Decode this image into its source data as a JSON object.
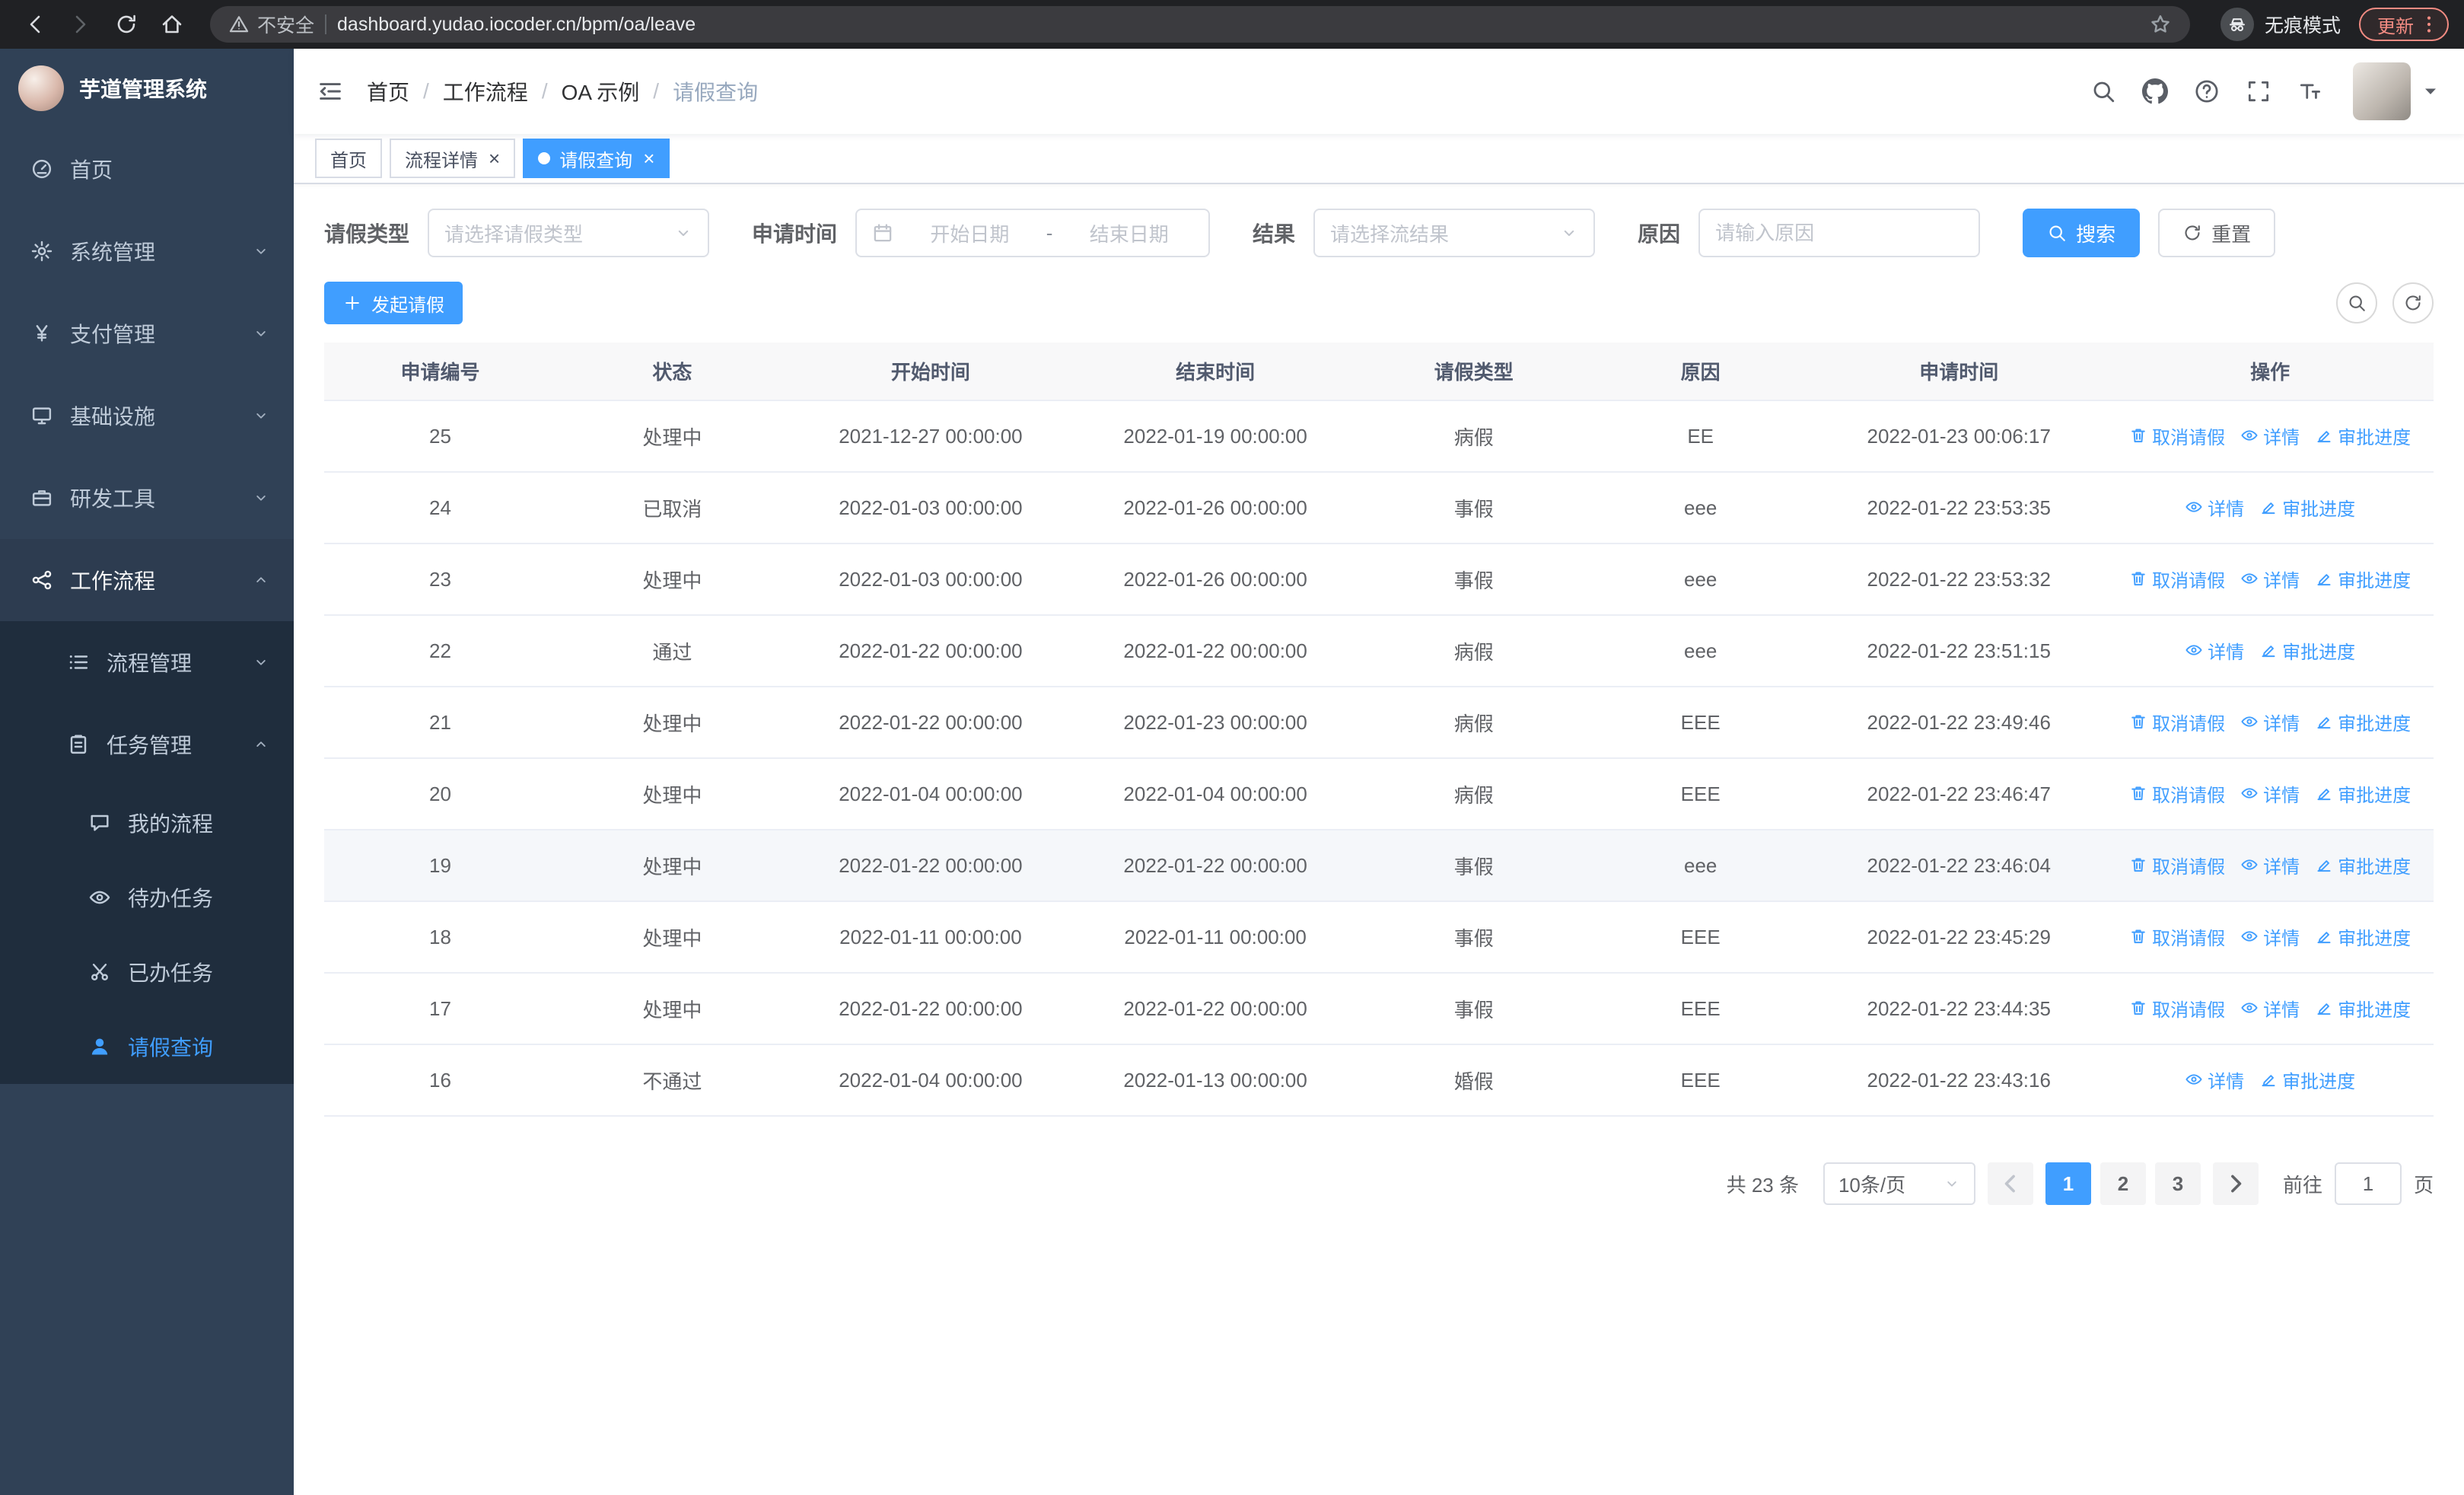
{
  "browser": {
    "security_label": "不安全",
    "url": "dashboard.yudao.iocoder.cn/bpm/oa/leave",
    "incognito_label": "无痕模式",
    "update_label": "更新"
  },
  "sidebar": {
    "title": "芋道管理系统",
    "items": [
      {
        "label": "首页",
        "icon": "dashboard-icon",
        "group": false,
        "expanded": false
      },
      {
        "label": "系统管理",
        "icon": "gear-icon",
        "group": true,
        "expanded": false
      },
      {
        "label": "支付管理",
        "icon": "yen-icon",
        "group": true,
        "expanded": false
      },
      {
        "label": "基础设施",
        "icon": "monitor-icon",
        "group": true,
        "expanded": false
      },
      {
        "label": "研发工具",
        "icon": "briefcase-icon",
        "group": true,
        "expanded": false
      },
      {
        "label": "工作流程",
        "icon": "workflow-icon",
        "group": true,
        "expanded": true
      }
    ],
    "submenu": [
      {
        "label": "流程管理",
        "icon": "list-icon",
        "level": 1,
        "group": true,
        "expanded": false,
        "active": false
      },
      {
        "label": "任务管理",
        "icon": "clipboard-icon",
        "level": 1,
        "group": true,
        "expanded": true,
        "active": false
      },
      {
        "label": "我的流程",
        "icon": "chat-icon",
        "level": 2,
        "group": false,
        "active": false
      },
      {
        "label": "待办任务",
        "icon": "eye-icon",
        "level": 2,
        "group": false,
        "active": false
      },
      {
        "label": "已办任务",
        "icon": "scissors-icon",
        "level": 2,
        "group": false,
        "active": false
      },
      {
        "label": "请假查询",
        "icon": "user-icon",
        "level": 2,
        "group": false,
        "active": true
      }
    ]
  },
  "header": {
    "breadcrumb": [
      "首页",
      "工作流程",
      "OA 示例",
      "请假查询"
    ]
  },
  "tabs": [
    {
      "label": "首页",
      "closable": false,
      "active": false
    },
    {
      "label": "流程详情",
      "closable": true,
      "active": false
    },
    {
      "label": "请假查询",
      "closable": true,
      "active": true
    }
  ],
  "filters": {
    "leave_type_label": "请假类型",
    "leave_type_placeholder": "请选择请假类型",
    "apply_time_label": "申请时间",
    "start_date_placeholder": "开始日期",
    "range_separator": "-",
    "end_date_placeholder": "结束日期",
    "result_label": "结果",
    "result_placeholder": "请选择流结果",
    "reason_label": "原因",
    "reason_placeholder": "请输入原因",
    "search_button": "搜索",
    "reset_button": "重置"
  },
  "toolbar": {
    "create_button": "发起请假"
  },
  "table": {
    "columns": [
      "申请编号",
      "状态",
      "开始时间",
      "结束时间",
      "请假类型",
      "原因",
      "申请时间",
      "操作"
    ],
    "action_labels": {
      "cancel": "取消请假",
      "detail": "详情",
      "progress": "审批进度"
    },
    "rows": [
      {
        "id": "25",
        "status": "处理中",
        "start": "2021-12-27 00:00:00",
        "end": "2022-01-19 00:00:00",
        "type": "病假",
        "reason": "EE",
        "apply_time": "2022-01-23 00:06:17",
        "actions": [
          "cancel",
          "detail",
          "progress"
        ],
        "highlighted": false
      },
      {
        "id": "24",
        "status": "已取消",
        "start": "2022-01-03 00:00:00",
        "end": "2022-01-26 00:00:00",
        "type": "事假",
        "reason": "eee",
        "apply_time": "2022-01-22 23:53:35",
        "actions": [
          "detail",
          "progress"
        ],
        "highlighted": false
      },
      {
        "id": "23",
        "status": "处理中",
        "start": "2022-01-03 00:00:00",
        "end": "2022-01-26 00:00:00",
        "type": "事假",
        "reason": "eee",
        "apply_time": "2022-01-22 23:53:32",
        "actions": [
          "cancel",
          "detail",
          "progress"
        ],
        "highlighted": false
      },
      {
        "id": "22",
        "status": "通过",
        "start": "2022-01-22 00:00:00",
        "end": "2022-01-22 00:00:00",
        "type": "病假",
        "reason": "eee",
        "apply_time": "2022-01-22 23:51:15",
        "actions": [
          "detail",
          "progress"
        ],
        "highlighted": false
      },
      {
        "id": "21",
        "status": "处理中",
        "start": "2022-01-22 00:00:00",
        "end": "2022-01-23 00:00:00",
        "type": "病假",
        "reason": "EEE",
        "apply_time": "2022-01-22 23:49:46",
        "actions": [
          "cancel",
          "detail",
          "progress"
        ],
        "highlighted": false
      },
      {
        "id": "20",
        "status": "处理中",
        "start": "2022-01-04 00:00:00",
        "end": "2022-01-04 00:00:00",
        "type": "病假",
        "reason": "EEE",
        "apply_time": "2022-01-22 23:46:47",
        "actions": [
          "cancel",
          "detail",
          "progress"
        ],
        "highlighted": false
      },
      {
        "id": "19",
        "status": "处理中",
        "start": "2022-01-22 00:00:00",
        "end": "2022-01-22 00:00:00",
        "type": "事假",
        "reason": "eee",
        "apply_time": "2022-01-22 23:46:04",
        "actions": [
          "cancel",
          "detail",
          "progress"
        ],
        "highlighted": true
      },
      {
        "id": "18",
        "status": "处理中",
        "start": "2022-01-11 00:00:00",
        "end": "2022-01-11 00:00:00",
        "type": "事假",
        "reason": "EEE",
        "apply_time": "2022-01-22 23:45:29",
        "actions": [
          "cancel",
          "detail",
          "progress"
        ],
        "highlighted": false
      },
      {
        "id": "17",
        "status": "处理中",
        "start": "2022-01-22 00:00:00",
        "end": "2022-01-22 00:00:00",
        "type": "事假",
        "reason": "EEE",
        "apply_time": "2022-01-22 23:44:35",
        "actions": [
          "cancel",
          "detail",
          "progress"
        ],
        "highlighted": false
      },
      {
        "id": "16",
        "status": "不通过",
        "start": "2022-01-04 00:00:00",
        "end": "2022-01-13 00:00:00",
        "type": "婚假",
        "reason": "EEE",
        "apply_time": "2022-01-22 23:43:16",
        "actions": [
          "detail",
          "progress"
        ],
        "highlighted": false
      }
    ]
  },
  "pagination": {
    "total_text": "共 23 条",
    "page_size": "10条/页",
    "pages": [
      "1",
      "2",
      "3"
    ],
    "active_page": "1",
    "goto_label": "前往",
    "goto_value": "1",
    "goto_suffix": "页"
  },
  "icons": {
    "header": [
      "search-icon",
      "github-icon",
      "help-icon",
      "fullscreen-icon",
      "font-size-icon"
    ],
    "action_cancel": "trash-icon",
    "action_detail": "eye-icon",
    "action_progress": "edit-icon",
    "create": "plus-icon"
  },
  "colors": {
    "accent": "#409eff",
    "sidebar_bg": "#304156",
    "submenu_bg": "#1f2d3d",
    "table_header_bg": "#f8f8f9",
    "update_pill": "#f28b82"
  }
}
